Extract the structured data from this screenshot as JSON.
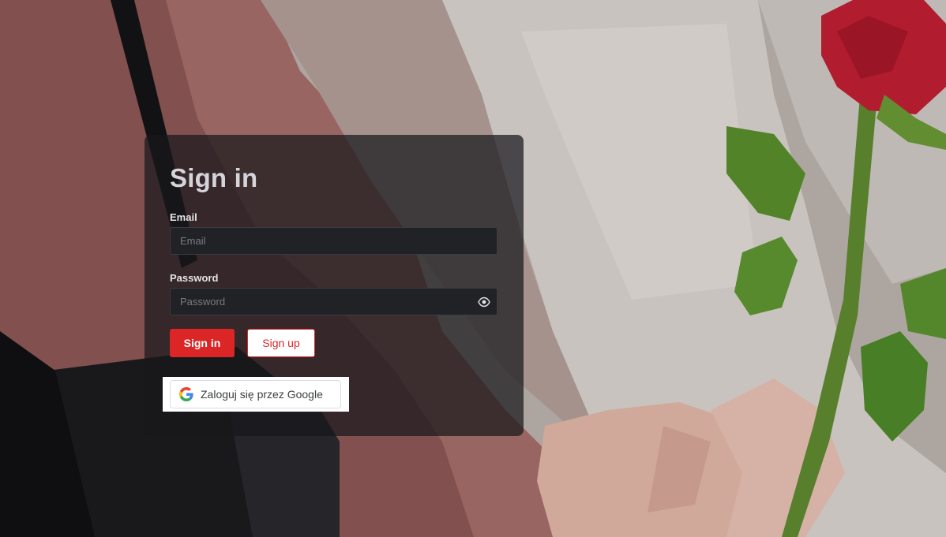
{
  "page": {
    "heading": "Sign in"
  },
  "form": {
    "email": {
      "label": "Email",
      "placeholder": "Email",
      "value": ""
    },
    "password": {
      "label": "Password",
      "placeholder": "Password",
      "value": ""
    }
  },
  "actions": {
    "sign_in_label": "Sign in",
    "sign_up_label": "Sign up",
    "google_label": "Zaloguj się przez Google"
  },
  "icons": {
    "password_toggle": "eye-icon",
    "google_logo": "google-logo-icon"
  },
  "colors": {
    "accent": "#dc2626",
    "card_background": "#18181c",
    "input_background": "#212226"
  }
}
